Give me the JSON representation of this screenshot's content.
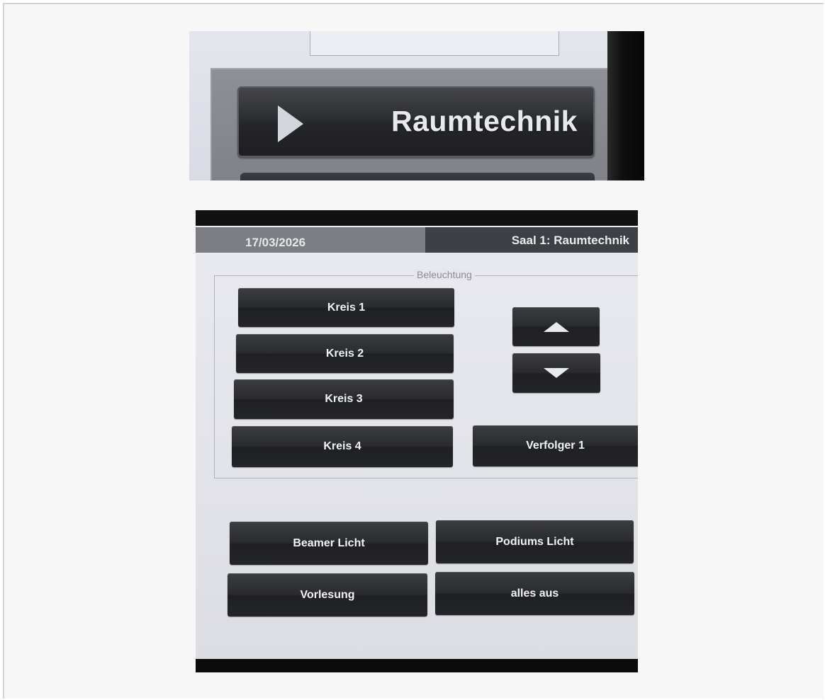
{
  "closeup": {
    "button_label": "Raumtechnik",
    "button_icon": "play-icon"
  },
  "header": {
    "date": "17/03/2026",
    "title": "Saal 1: Raumtechnik"
  },
  "lighting": {
    "group_label": "Beleuchtung",
    "circuits": [
      "Kreis 1",
      "Kreis 2",
      "Kreis 3",
      "Kreis 4"
    ],
    "up_icon": "arrow-up-icon",
    "down_icon": "arrow-down-icon",
    "follow_spot": "Verfolger 1"
  },
  "presets": {
    "beamer": "Beamer Licht",
    "podium": "Podiums Licht",
    "lecture": "Vorlesung",
    "all_off": "alles aus"
  }
}
